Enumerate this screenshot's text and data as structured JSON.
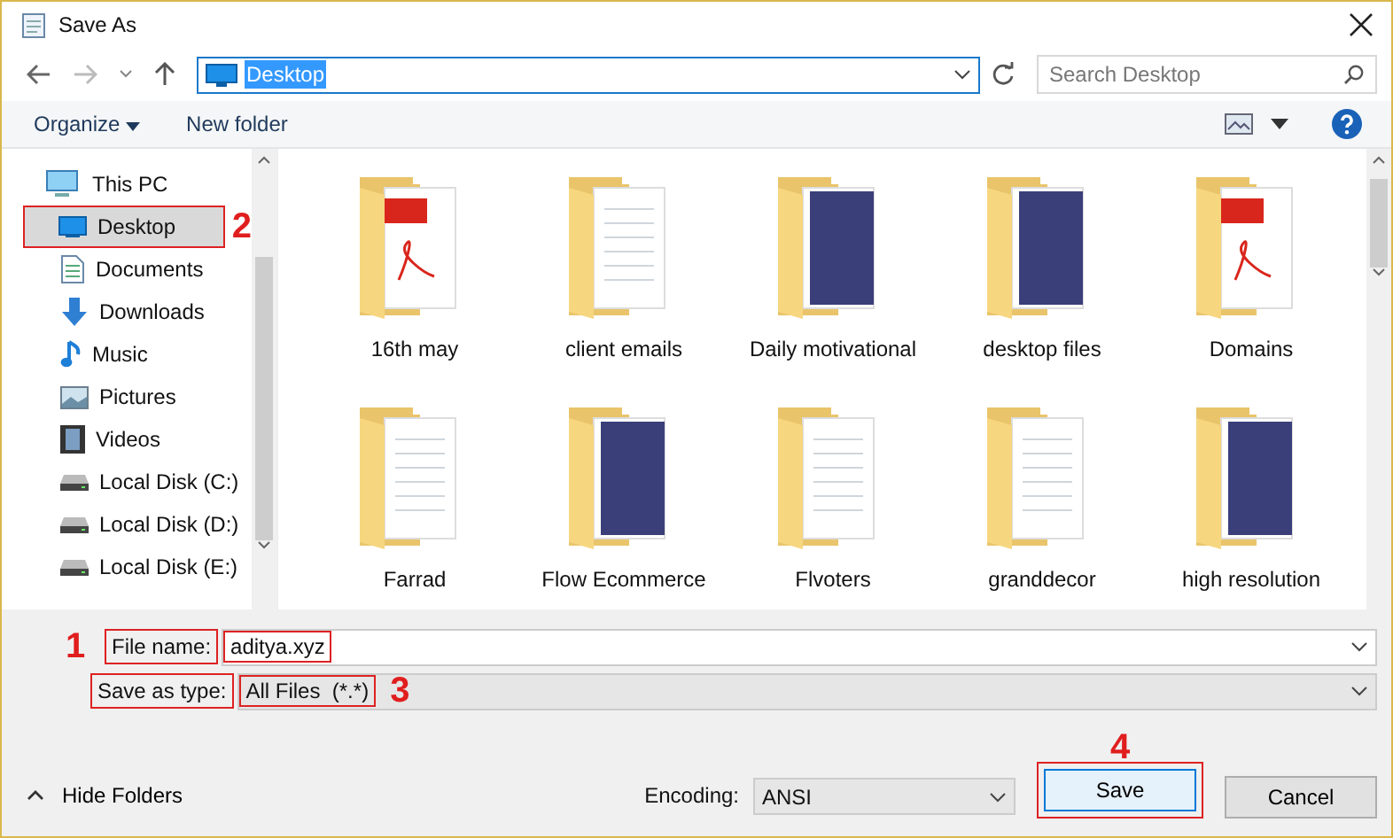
{
  "window": {
    "title": "Save As"
  },
  "address": {
    "value": "Desktop"
  },
  "search": {
    "placeholder": "Search Desktop"
  },
  "toolbar": {
    "organize": "Organize",
    "new_folder": "New folder"
  },
  "sidebar": {
    "root": "This PC",
    "items": [
      {
        "label": "Desktop",
        "kind": "desktop",
        "selected": true,
        "callout": "2"
      },
      {
        "label": "Documents",
        "kind": "documents",
        "selected": false
      },
      {
        "label": "Downloads",
        "kind": "downloads",
        "selected": false
      },
      {
        "label": "Music",
        "kind": "music",
        "selected": false
      },
      {
        "label": "Pictures",
        "kind": "pictures",
        "selected": false
      },
      {
        "label": "Videos",
        "kind": "videos",
        "selected": false
      },
      {
        "label": "Local Disk (C:)",
        "kind": "disk",
        "selected": false
      },
      {
        "label": "Local Disk (D:)",
        "kind": "disk",
        "selected": false
      },
      {
        "label": "Local Disk (E:)",
        "kind": "disk",
        "selected": false
      }
    ]
  },
  "folders": [
    {
      "name": "16th may",
      "kind": "pdf"
    },
    {
      "name": "client emails",
      "kind": "document"
    },
    {
      "name": "Daily motivational",
      "kind": "photo"
    },
    {
      "name": "desktop files",
      "kind": "photo"
    },
    {
      "name": "Domains",
      "kind": "pdf"
    },
    {
      "name": "Farrad",
      "kind": "document"
    },
    {
      "name": "Flow Ecommerce",
      "kind": "photo"
    },
    {
      "name": "Flvoters",
      "kind": "document"
    },
    {
      "name": "granddecor",
      "kind": "document"
    },
    {
      "name": "high resolution",
      "kind": "photo"
    }
  ],
  "file_name": {
    "label": "File name:",
    "value": "aditya.xyz",
    "callout": "1"
  },
  "save_as_type": {
    "label": "Save as type:",
    "value": "All Files  (*.*)",
    "callout": "3"
  },
  "hide_folders": "Hide Folders",
  "encoding": {
    "label": "Encoding:",
    "value": "ANSI"
  },
  "buttons": [
    {
      "label": "Save",
      "primary": true,
      "callout": "4"
    },
    {
      "label": "Cancel",
      "primary": false
    }
  ]
}
